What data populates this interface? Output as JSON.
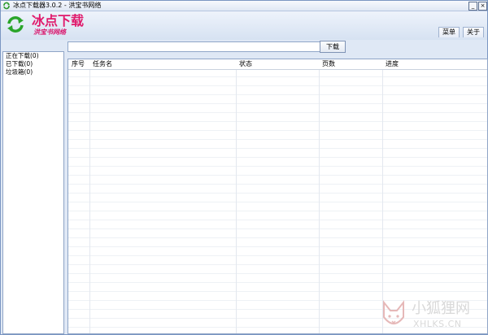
{
  "window": {
    "title": "冰点下载器3.0.2 - 洪宝书网络",
    "controls": {
      "minimize": "_",
      "close": "×"
    }
  },
  "header": {
    "brand": "冰点下载",
    "brand_sub": "洪宝书网络",
    "menu_label": "菜单",
    "about_label": "关于"
  },
  "sidebar": {
    "items": [
      {
        "label": "正在下载(0)"
      },
      {
        "label": "已下载(0)"
      },
      {
        "label": "垃圾箱(0)"
      }
    ]
  },
  "toolbar": {
    "url_value": "",
    "download_label": "下载"
  },
  "table": {
    "columns": [
      "序号",
      "任务名",
      "状态",
      "页数",
      "进度"
    ],
    "rows": []
  },
  "watermark": {
    "cn": "小狐狸网",
    "en": "XHLKS.CN"
  },
  "colors": {
    "brand": "#e0196b",
    "frame_border": "#7a96c2",
    "background": "#dfe8f5"
  }
}
